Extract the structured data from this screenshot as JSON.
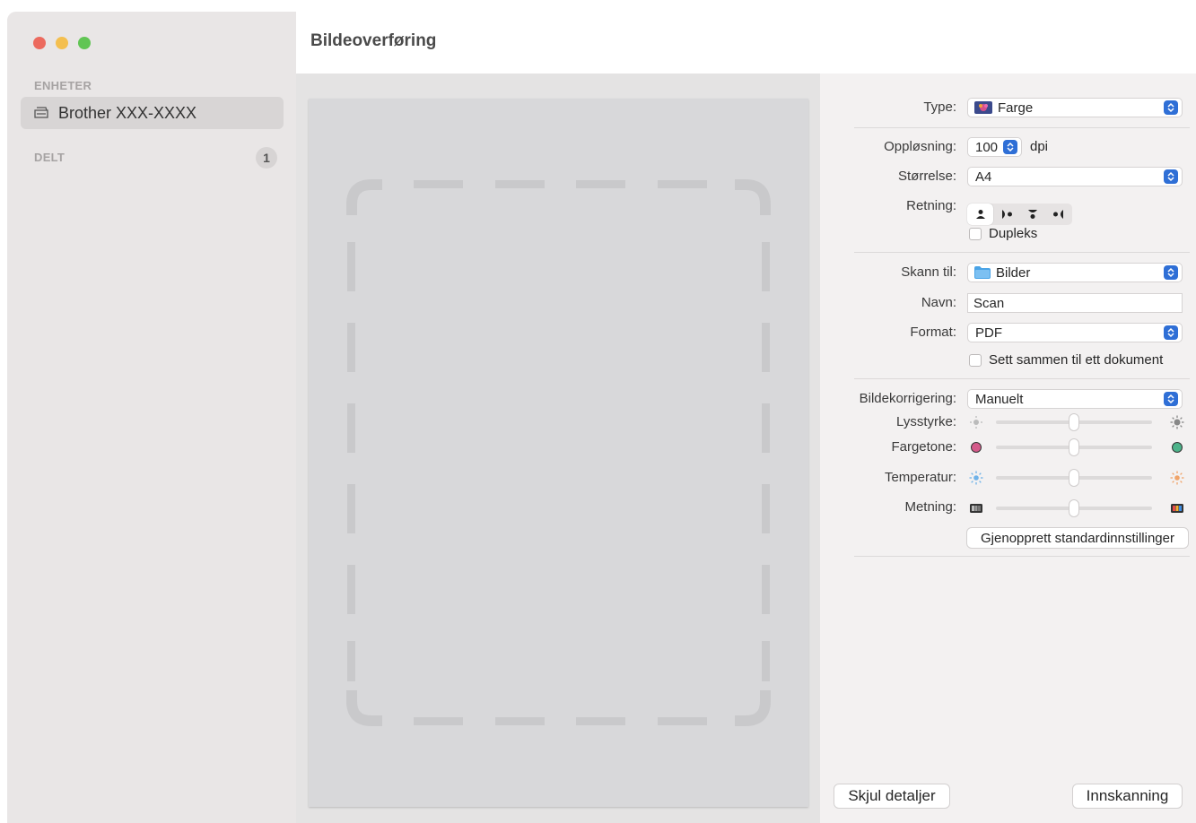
{
  "window": {
    "title": "Bildeoverføring"
  },
  "sidebar": {
    "devices_label": "ENHETER",
    "device_name": "Brother XXX-XXXX",
    "shared_label": "DELT",
    "shared_count": "1"
  },
  "settings": {
    "type_label": "Type:",
    "type_value": "Farge",
    "resolution_label": "Oppløsning:",
    "resolution_value": "100",
    "resolution_unit": "dpi",
    "size_label": "Størrelse:",
    "size_value": "A4",
    "orientation_label": "Retning:",
    "duplex_label": "Dupleks",
    "scan_to_label": "Skann til:",
    "scan_to_value": "Bilder",
    "name_label": "Navn:",
    "name_value": "Scan",
    "format_label": "Format:",
    "format_value": "PDF",
    "combine_label": "Sett sammen til ett dokument",
    "correction_label": "Bildekorrigering:",
    "correction_value": "Manuelt",
    "brightness_label": "Lysstyrke:",
    "tint_label": "Fargetone:",
    "temperature_label": "Temperatur:",
    "saturation_label": "Metning:",
    "reset_button": "Gjenopprett standardinnstillinger",
    "brightness_level": 0.5,
    "tint_level": 0.5,
    "temperature_level": 0.5,
    "saturation_level": 0.5
  },
  "footer": {
    "hide_details_button": "Skjul detaljer",
    "scan_button": "Innskanning"
  },
  "colors": {
    "accent": "#2f6fd6",
    "close": "#ec6a5e",
    "minimize": "#f4bf4f",
    "zoom": "#61c554"
  }
}
